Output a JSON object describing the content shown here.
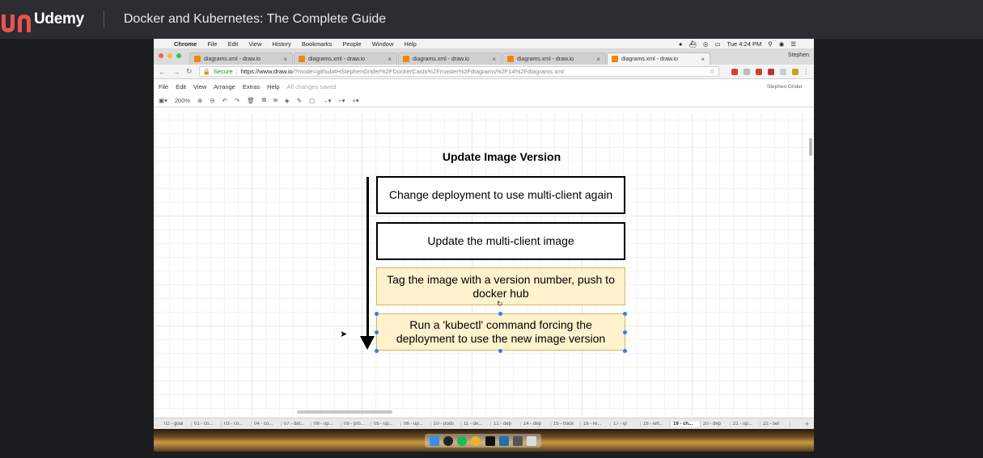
{
  "udemy": {
    "brand": "Udemy",
    "course_title": "Docker and Kubernetes: The Complete Guide"
  },
  "mac_menubar": {
    "items": [
      "Chrome",
      "File",
      "Edit",
      "View",
      "History",
      "Bookmarks",
      "People",
      "Window",
      "Help"
    ],
    "clock": "Tue 4:24 PM"
  },
  "browser": {
    "tabs": [
      {
        "label": "diagrams.xml - draw.io"
      },
      {
        "label": "diagrams.xml - draw.io"
      },
      {
        "label": "diagrams.xml - draw.io"
      },
      {
        "label": "diagrams.xml - draw.io"
      },
      {
        "label": "diagrams.xml - draw.io"
      }
    ],
    "profile": "Stephen",
    "secure_label": "Secure",
    "url_host": "https://www.draw.io",
    "url_rest": "/?mode=github#HStephenGrider%2FDockerCasts%2Fmaster%2Fdiagrams%2F14%2Fdiagrams.xml"
  },
  "drawio": {
    "menus": [
      "File",
      "Edit",
      "View",
      "Arrange",
      "Extras",
      "Help"
    ],
    "save_status": "All changes saved",
    "account": "Stephen Grider",
    "zoom": "200%"
  },
  "diagram": {
    "title": "Update Image Version",
    "steps": [
      "Change deployment to use multi-client again",
      "Update the multi-client image",
      "Tag the image with a version number, push to docker hub",
      "Run a 'kubectl' command forcing the deployment to use the new image version"
    ]
  },
  "page_tabs": [
    "02 - goal",
    "01 - co...",
    "03 - co...",
    "04 - co...",
    "07 - det...",
    "08 - up...",
    "09 - pro...",
    "05 - up...",
    "06 - up...",
    "10 - pods",
    "11 - de...",
    "12 - dep",
    "14 - dep",
    "15 - track",
    "16 - re...",
    "17 - ip",
    "18 - wh...",
    "19 - ch...",
    "20 - dep",
    "21 - up...",
    "22 - set"
  ],
  "active_page_tab": "19 - ch...",
  "colors": {
    "udemy_accent": "#ec5252",
    "step_highlight_fill": "#fff2cc",
    "step_highlight_border": "#d6b656",
    "selection": "#2a7fff"
  }
}
